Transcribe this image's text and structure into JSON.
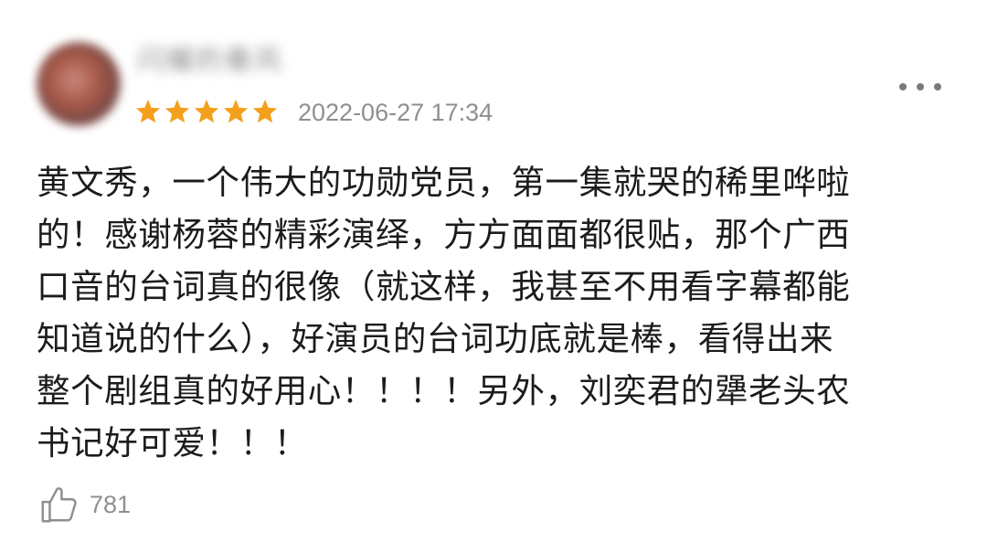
{
  "review": {
    "user": {
      "name": "闪耀的春风",
      "avatar_icon": "user-avatar"
    },
    "rating": {
      "stars": 5,
      "max": 5,
      "color": "#f4a01c"
    },
    "timestamp": "2022-06-27 17:34",
    "more_icon": "more-options-icon",
    "lines": [
      "黄文秀，一个伟大的功勋党员，第一集就哭的稀里哗啦",
      "的！感谢杨蓉的精彩演绎，方方面面都很贴，那个广西",
      "口音的台词真的很像（就这样，我甚至不用看字幕都能",
      "知道说的什么），好演员的台词功底就是棒，看得出来",
      "整个剧组真的好用心！！！！另外，刘奕君的犟老头农",
      "书记好可爱！！！"
    ],
    "likes": {
      "icon": "thumbs-up-icon",
      "count": "781"
    }
  }
}
